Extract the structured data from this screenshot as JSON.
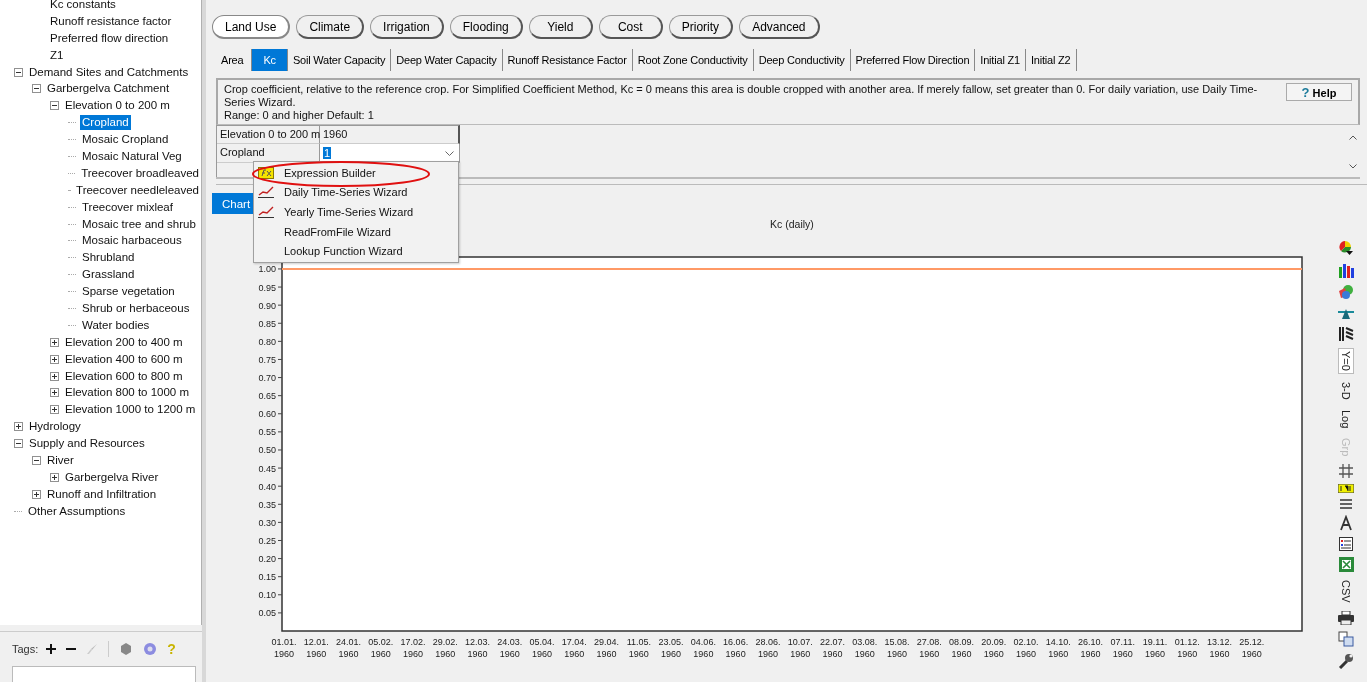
{
  "tree": {
    "scrolled_branch": [
      "Kc constants",
      "Runoff resistance factor",
      "Preferred flow direction",
      "Z1"
    ],
    "items": [
      {
        "label": "Demand Sites and Catchments",
        "expanded": true,
        "selected": false,
        "children": [
          {
            "label": "Garbergelva Catchment",
            "expanded": true,
            "selected": false,
            "children": [
              {
                "label": "Elevation 0 to 200 m",
                "expanded": true,
                "selected": false,
                "children": [
                  {
                    "label": "Cropland",
                    "selected": true
                  },
                  {
                    "label": "Mosaic Cropland",
                    "selected": false
                  },
                  {
                    "label": "Mosaic Natural Veg",
                    "selected": false
                  },
                  {
                    "label": "Treecover broadleaved",
                    "selected": false
                  },
                  {
                    "label": "Treecover needleleaved",
                    "selected": false
                  },
                  {
                    "label": "Treecover mixleaf",
                    "selected": false
                  },
                  {
                    "label": "Mosaic tree and shrub",
                    "selected": false
                  },
                  {
                    "label": "Mosaic harbaceous",
                    "selected": false
                  },
                  {
                    "label": "Shrubland",
                    "selected": false
                  },
                  {
                    "label": "Grassland",
                    "selected": false
                  },
                  {
                    "label": "Sparse vegetation",
                    "selected": false
                  },
                  {
                    "label": "Shrub or herbaceous",
                    "selected": false
                  },
                  {
                    "label": "Water bodies",
                    "selected": false
                  }
                ]
              },
              {
                "label": "Elevation 200 to 400 m",
                "expanded": false,
                "selected": false
              },
              {
                "label": "Elevation 400 to 600 m",
                "expanded": false,
                "selected": false
              },
              {
                "label": "Elevation 600 to 800 m",
                "expanded": false,
                "selected": false
              },
              {
                "label": "Elevation 800 to 1000 m",
                "expanded": false,
                "selected": false
              },
              {
                "label": "Elevation 1000 to 1200 m",
                "expanded": false,
                "selected": false
              }
            ]
          }
        ]
      },
      {
        "label": "Hydrology",
        "expanded": false,
        "selected": false
      },
      {
        "label": "Supply and Resources",
        "expanded": true,
        "selected": false,
        "children": [
          {
            "label": "River",
            "expanded": true,
            "selected": false,
            "children": [
              {
                "label": "Garbergelva River",
                "expanded": false,
                "selected": false
              }
            ]
          },
          {
            "label": "Runoff and Infiltration",
            "expanded": false,
            "selected": false
          }
        ]
      },
      {
        "label": "Other Assumptions",
        "selected": false
      }
    ]
  },
  "tags_bar": {
    "label": "Tags:",
    "help_icon": "?"
  },
  "category_tabs": [
    {
      "label": "Land Use",
      "selected": true
    },
    {
      "label": "Climate",
      "selected": false
    },
    {
      "label": "Irrigation",
      "selected": false
    },
    {
      "label": "Flooding",
      "selected": false
    },
    {
      "label": "Yield",
      "selected": false
    },
    {
      "label": "Cost",
      "selected": false
    },
    {
      "label": "Priority",
      "selected": false
    },
    {
      "label": "Advanced",
      "selected": false
    }
  ],
  "variable_tabs": [
    {
      "label": "Area",
      "selected": false
    },
    {
      "label": "Kc",
      "selected": true
    },
    {
      "label": "Soil Water Capacity",
      "selected": false
    },
    {
      "label": "Deep Water Capacity",
      "selected": false
    },
    {
      "label": "Runoff Resistance Factor",
      "selected": false
    },
    {
      "label": "Root Zone Conductivity",
      "selected": false
    },
    {
      "label": "Deep Conductivity",
      "selected": false
    },
    {
      "label": "Preferred Flow Direction",
      "selected": false
    },
    {
      "label": "Initial Z1",
      "selected": false
    },
    {
      "label": "Initial Z2",
      "selected": false
    }
  ],
  "description": {
    "text": "Crop coefficient, relative to the reference crop. For Simplified Coefficient Method, Kc = 0 means this area is double cropped with another area.  If merely fallow, set greater than 0.  For daily variation, use Daily Time-Series Wizard.",
    "range": "Range: 0 and higher   Default: 1"
  },
  "help_button": {
    "icon": "?",
    "label": "Help"
  },
  "grid": {
    "header": [
      "Elevation 0 to 200 m",
      "1960"
    ],
    "row_label": "Cropland",
    "value": "1"
  },
  "dropdown_menu": [
    {
      "label": "Expression Builder",
      "kind": "expression"
    },
    {
      "label": "Daily Time-Series Wizard",
      "kind": "trend"
    },
    {
      "label": "Yearly Time-Series Wizard",
      "kind": "trend"
    },
    {
      "label": "ReadFromFile Wizard",
      "kind": "none"
    },
    {
      "label": "Lookup Function Wizard",
      "kind": "none"
    }
  ],
  "view_tabs": [
    {
      "label": "Chart",
      "selected": true
    }
  ],
  "chart_data": {
    "type": "line",
    "title": "Kc (daily)",
    "categories": [
      "01.01. 1960",
      "12.01. 1960",
      "24.01. 1960",
      "05.02. 1960",
      "17.02. 1960",
      "29.02. 1960",
      "12.03. 1960",
      "24.03. 1960",
      "05.04. 1960",
      "17.04. 1960",
      "29.04. 1960",
      "11.05. 1960",
      "23.05. 1960",
      "04.06. 1960",
      "16.06. 1960",
      "28.06. 1960",
      "10.07. 1960",
      "22.07. 1960",
      "03.08. 1960",
      "15.08. 1960",
      "27.08. 1960",
      "08.09. 1960",
      "20.09. 1960",
      "02.10. 1960",
      "14.10. 1960",
      "26.10. 1960",
      "07.11. 1960",
      "19.11. 1960",
      "01.12. 1960",
      "13.12. 1960",
      "25.12. 1960"
    ],
    "series": [
      {
        "color": "#ff9966",
        "values": [
          1,
          1,
          1,
          1,
          1,
          1,
          1,
          1,
          1,
          1,
          1,
          1,
          1,
          1,
          1,
          1,
          1,
          1,
          1,
          1,
          1,
          1,
          1,
          1,
          1,
          1,
          1,
          1,
          1,
          1,
          1
        ]
      }
    ],
    "ylim": [
      0,
      1.033
    ],
    "yticks": [
      {
        "value": 1,
        "label": "1.00"
      },
      {
        "value": 0.95,
        "label": "0.95"
      },
      {
        "value": 0.9,
        "label": "0.90"
      },
      {
        "value": 0.85,
        "label": "0.85"
      },
      {
        "value": 0.8,
        "label": "0.80"
      },
      {
        "value": 0.75,
        "label": "0.75"
      },
      {
        "value": 0.7,
        "label": "0.70"
      },
      {
        "value": 0.65,
        "label": "0.65"
      },
      {
        "value": 0.6,
        "label": "0.60"
      },
      {
        "value": 0.55,
        "label": "0.55"
      },
      {
        "value": 0.5,
        "label": "0.50"
      },
      {
        "value": 0.45,
        "label": "0.45"
      },
      {
        "value": 0.4,
        "label": "0.40"
      },
      {
        "value": 0.35,
        "label": "0.35"
      },
      {
        "value": 0.3,
        "label": "0.30"
      },
      {
        "value": 0.25,
        "label": "0.25"
      },
      {
        "value": 0.2,
        "label": "0.20"
      },
      {
        "value": 0.15,
        "label": "0.15"
      },
      {
        "value": 0.1,
        "label": "0.10"
      },
      {
        "value": 0.05,
        "label": "0.05"
      }
    ]
  },
  "chart_toolbar": [
    {
      "kind": "pie"
    },
    {
      "kind": "bars"
    },
    {
      "kind": "shapes"
    },
    {
      "kind": "balance"
    },
    {
      "kind": "hatch"
    },
    {
      "kind": "text",
      "label": "Y=0",
      "selected": true,
      "disabled": false
    },
    {
      "kind": "text",
      "label": "3-D",
      "selected": false,
      "disabled": false
    },
    {
      "kind": "text",
      "label": "Log",
      "selected": false,
      "disabled": false
    },
    {
      "kind": "text",
      "label": "Grp",
      "selected": false,
      "disabled": true
    },
    {
      "kind": "grid"
    },
    {
      "kind": "numbers"
    },
    {
      "kind": "lines"
    },
    {
      "kind": "font"
    },
    {
      "kind": "table"
    },
    {
      "kind": "excel"
    },
    {
      "kind": "text",
      "label": "CSV",
      "selected": false,
      "disabled": false
    },
    {
      "kind": "printer"
    },
    {
      "kind": "copy"
    },
    {
      "kind": "wrench"
    }
  ]
}
